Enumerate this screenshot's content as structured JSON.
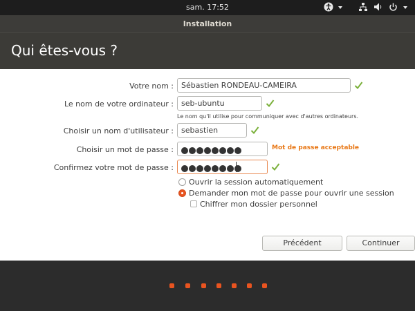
{
  "top_bar": {
    "clock": "sam. 17:52",
    "icons": [
      "accessibility-icon",
      "network-icon",
      "volume-icon",
      "power-icon"
    ]
  },
  "window": {
    "title": "Installation"
  },
  "page": {
    "title": "Qui êtes-vous ?"
  },
  "form": {
    "name": {
      "label": "Votre nom :",
      "value": "Sébastien RONDEAU-CAMEIRA"
    },
    "computer": {
      "label": "Le nom de votre ordinateur :",
      "value": "seb-ubuntu",
      "hint": "Le nom qu'il utilise pour communiquer avec d'autres ordinateurs."
    },
    "username": {
      "label": "Choisir un nom d'utilisateur :",
      "value": "sebastien"
    },
    "password": {
      "label": "Choisir un mot de passe :",
      "strength": "Mot de passe acceptable"
    },
    "confirm": {
      "label": "Confirmez votre mot de passe :"
    }
  },
  "login_options": {
    "auto": "Ouvrir la session automatiquement",
    "ask": "Demander mon mot de passe pour ouvrir une session",
    "encrypt": "Chiffrer mon dossier personnel",
    "selected": "ask"
  },
  "buttons": {
    "back": "Précédent",
    "continue": "Continuer"
  },
  "colors": {
    "accent": "#e95420",
    "check": "#7ab03a",
    "strength": "#e87715"
  }
}
